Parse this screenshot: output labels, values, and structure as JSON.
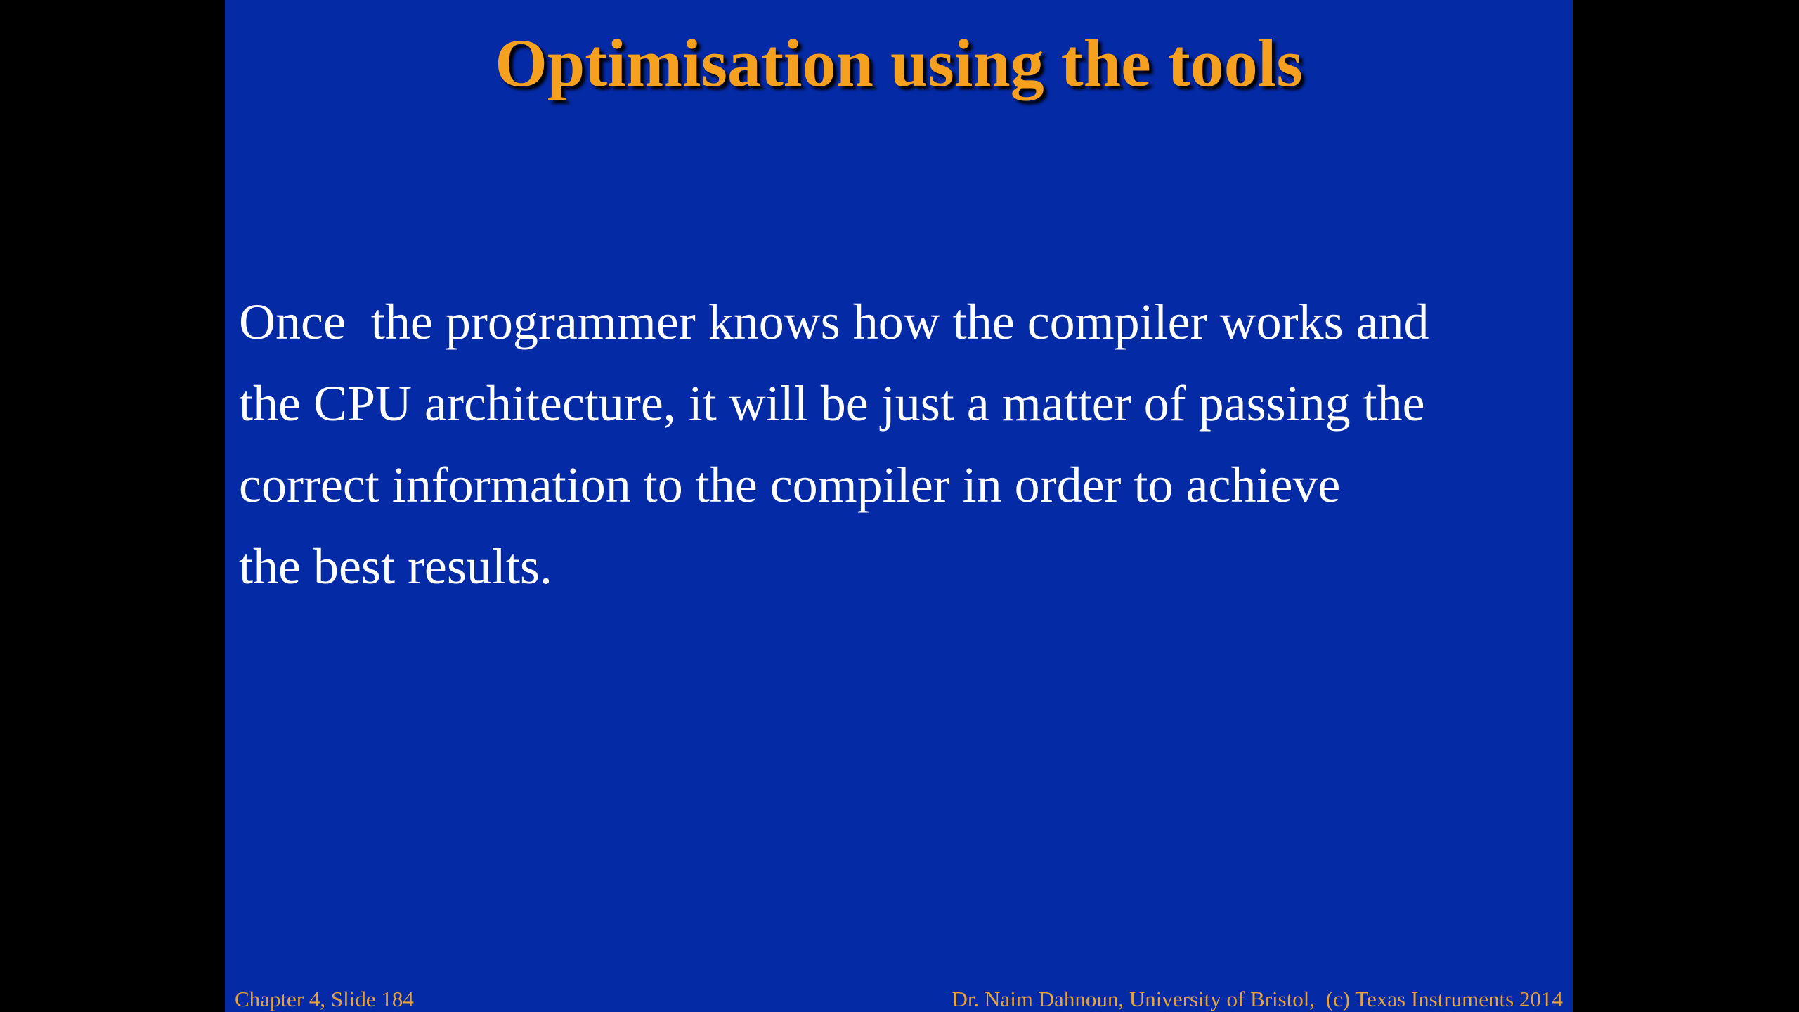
{
  "slide": {
    "title": "Optimisation using the tools",
    "body_lines": [
      "Once  the programmer knows how the compiler works and",
      "the CPU architecture, it will be just a matter of passing the",
      "correct information to the compiler in order to achieve",
      "the best results."
    ],
    "footer_left": "Chapter 4, Slide 184",
    "footer_right": "Dr. Naim Dahnoun, University of Bristol,  (c) Texas Instruments 2014"
  },
  "colors": {
    "background": "#000000",
    "slide_background": "#042aa5",
    "title": "#f5a01e",
    "body_text": "#ffffff",
    "footer_text": "#e8a23a"
  }
}
